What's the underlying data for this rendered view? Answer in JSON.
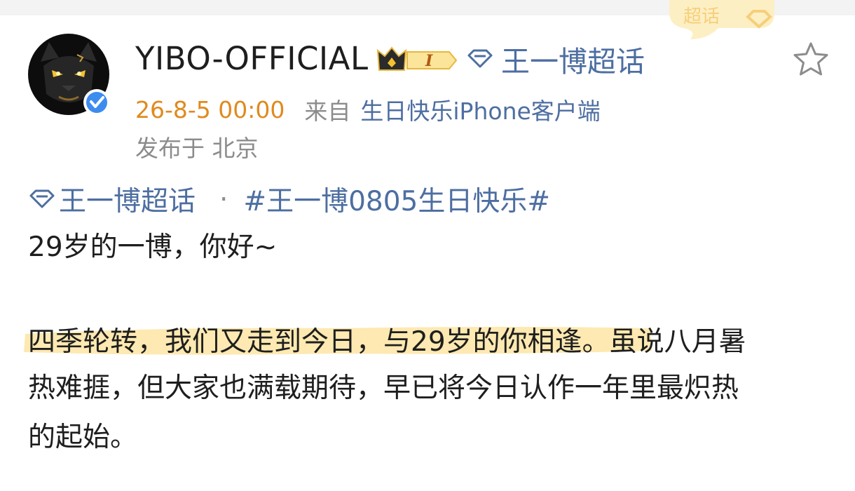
{
  "post": {
    "author": {
      "username": "YIBO-OFFICIAL",
      "avatar_icon": "black-panther-avatar",
      "verified_icon": "verified-badge-icon",
      "level_badge": "I"
    },
    "supertopic_header_label": "王一博超话",
    "corner_tag_text": "超话",
    "meta": {
      "time": "26-8-5 00:00",
      "from_label": "来自",
      "client": "生日快乐iPhone客户端",
      "location": "发布于 北京"
    },
    "topic_tag": "王一博超话",
    "separator": "·",
    "hashtag": "#王一博0805生日快乐#",
    "lines": [
      "29岁的一博，你好~",
      "四季轮转，我们又走到今日，与29岁的你相逢。虽说八月暑",
      "热难捱，但大家也满载期待，早已将今日认作一年里最炽热",
      "的起始。"
    ]
  },
  "colors": {
    "link_blue": "#4d6ea1",
    "time_orange": "#e08a1e",
    "meta_gray": "#8c8c8c",
    "highlight_yellow": "#fde7a8",
    "verified_blue": "#3c8cf0",
    "text": "#1e1e1e"
  }
}
